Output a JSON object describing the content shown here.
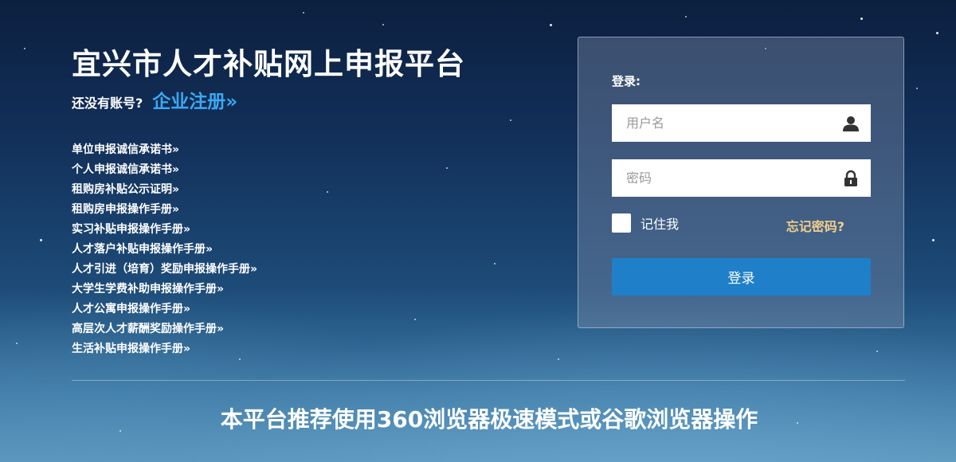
{
  "header": {
    "title": "宜兴市人才补贴网上申报平台",
    "register_prompt": "还没有账号?",
    "register_link": "企业注册»"
  },
  "documents": [
    "单位申报诚信承诺书»",
    "个人申报诚信承诺书»",
    "租购房补贴公示证明»",
    "租购房申报操作手册»",
    "实习补贴申报操作手册»",
    "人才落户补贴申报操作手册»",
    "人才引进（培育）奖励申报操作手册»",
    "大学生学费补助申报操作手册»",
    "人才公寓申报操作手册»",
    "高层次人才薪酬奖励操作手册»",
    "生活补贴申报操作手册»"
  ],
  "login": {
    "heading": "登录:",
    "username_placeholder": "用户名",
    "username_value": "",
    "username_icon": "user-icon",
    "password_placeholder": "密码",
    "password_value": "",
    "password_icon": "lock-icon",
    "remember_label": "记住我",
    "remember_checked": false,
    "forgot_label": "忘记密码?",
    "submit_label": "登录"
  },
  "footer": {
    "note": "本平台推荐使用360浏览器极速模式或谷歌浏览器操作"
  },
  "colors": {
    "link_blue": "#3aa8f0",
    "forgot_gold": "#f2cf8a",
    "button_blue": "#1f7fc9"
  }
}
